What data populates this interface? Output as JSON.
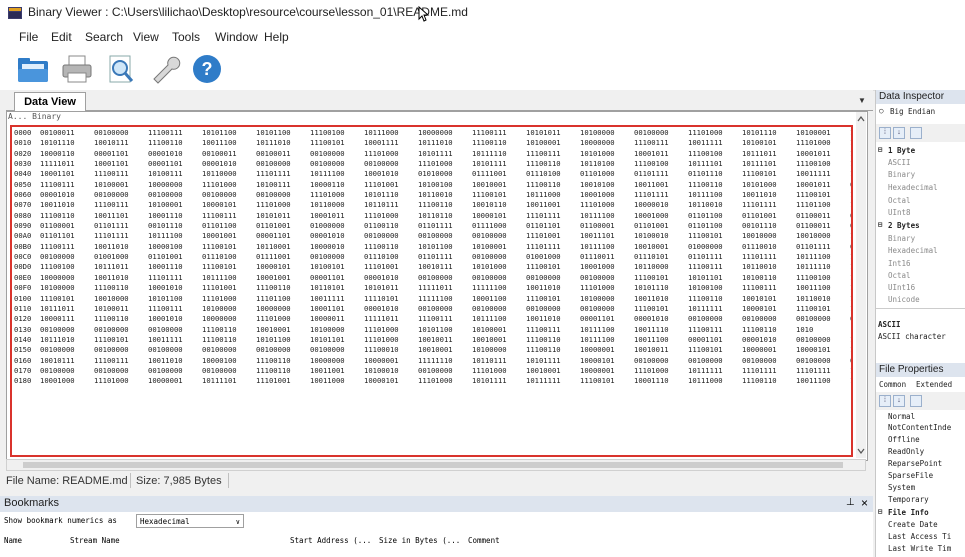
{
  "window": {
    "title": "Binary Viewer : C:\\Users\\lilichao\\Desktop\\resource\\course\\lesson_01\\README.md"
  },
  "menu": [
    "File",
    "Edit",
    "Search",
    "View",
    "Tools",
    "Window",
    "Help"
  ],
  "toolbar": {
    "icons": [
      "open-folder-icon",
      "print-icon",
      "print-preview-icon",
      "tools-wrench-icon",
      "help-icon"
    ]
  },
  "data_view": {
    "tab_label": "Data View",
    "col_header": "A... Binary",
    "rows": [
      {
        "addr": "0000",
        "cells": [
          "00100011",
          "00100000",
          "11100111",
          "10101100",
          "10101100",
          "11100100",
          "10111000",
          "10000000",
          "11100111",
          "10101011",
          "10100000",
          "00100000",
          "11101000",
          "10101110",
          "10100001",
          "1110"
        ]
      },
      {
        "addr": "0010",
        "cells": [
          "10101110",
          "10010111",
          "11100110",
          "10011100",
          "10111010",
          "11100101",
          "10001111",
          "10111010",
          "11100110",
          "10100001",
          "10000000",
          "11100111",
          "10011111",
          "10100101",
          "11101000",
          "1010"
        ]
      },
      {
        "addr": "0020",
        "cells": [
          "10000110",
          "00001101",
          "00001010",
          "00100011",
          "00100011",
          "00100000",
          "11101000",
          "10101111",
          "10111110",
          "11100111",
          "10101000",
          "10001011",
          "11100100",
          "10111011",
          "10001011",
          "1110"
        ]
      },
      {
        "addr": "0030",
        "cells": [
          "11111011",
          "10001101",
          "00001101",
          "00001010",
          "00100000",
          "00100000",
          "00100000",
          "11101000",
          "10101111",
          "11100110",
          "10110100",
          "11100100",
          "10111101",
          "10111101",
          "11100100",
          "1011"
        ]
      },
      {
        "addr": "0040",
        "cells": [
          "10001101",
          "11100111",
          "10100111",
          "10110000",
          "11101111",
          "10111100",
          "10001010",
          "01010000",
          "01111001",
          "01110100",
          "01101000",
          "01101111",
          "01101110",
          "11100101",
          "10011111",
          "1010"
        ]
      },
      {
        "addr": "0050",
        "cells": [
          "11100111",
          "10100001",
          "10000000",
          "11101000",
          "10100111",
          "10000110",
          "11101001",
          "10100100",
          "10010001",
          "11100110",
          "10010100",
          "10011001",
          "11100110",
          "10101000",
          "10001011",
          "0000"
        ]
      },
      {
        "addr": "0060",
        "cells": [
          "00001010",
          "00100000",
          "00100000",
          "00100000",
          "00100000",
          "11101000",
          "10101110",
          "10110010",
          "11100101",
          "10111000",
          "10001000",
          "11101111",
          "10111100",
          "10011010",
          "11100101",
          "1011"
        ]
      },
      {
        "addr": "0070",
        "cells": [
          "10011010",
          "11100111",
          "10100001",
          "10000101",
          "11101000",
          "10110000",
          "10110111",
          "11100110",
          "10010110",
          "10011001",
          "11101000",
          "10000010",
          "10110010",
          "11101111",
          "11101100",
          "1000"
        ]
      },
      {
        "addr": "0080",
        "cells": [
          "11100110",
          "10011101",
          "10001110",
          "11100111",
          "10101011",
          "10001011",
          "11101000",
          "10110110",
          "10000101",
          "11101111",
          "10111100",
          "10001000",
          "01101100",
          "01101001",
          "01100011",
          "0110"
        ]
      },
      {
        "addr": "0090",
        "cells": [
          "01100001",
          "01101111",
          "00101110",
          "01101100",
          "01101001",
          "01000000",
          "01100110",
          "01101111",
          "01111000",
          "01101101",
          "01100001",
          "01101001",
          "01101100",
          "00101110",
          "01100011",
          "0110"
        ]
      },
      {
        "addr": "00A0",
        "cells": [
          "01101101",
          "11101111",
          "10111100",
          "10001001",
          "00001101",
          "00001010",
          "00100000",
          "00100000",
          "00100000",
          "11101001",
          "10011101",
          "10100010",
          "11100101",
          "10010000",
          "10010000",
          "1001"
        ]
      },
      {
        "addr": "00B0",
        "cells": [
          "11100111",
          "10011010",
          "10000100",
          "11100101",
          "10110001",
          "10000010",
          "11100110",
          "10101100",
          "10100001",
          "11101111",
          "10111100",
          "10010001",
          "01000000",
          "01110010",
          "01101111",
          "0110"
        ]
      },
      {
        "addr": "00C0",
        "cells": [
          "00100000",
          "01001000",
          "01101001",
          "01110100",
          "01111001",
          "00100000",
          "01110100",
          "01101111",
          "00100000",
          "01001000",
          "01110011",
          "01110101",
          "01101111",
          "11101111",
          "10111100",
          "1000"
        ]
      },
      {
        "addr": "00D0",
        "cells": [
          "11100100",
          "10111011",
          "10001110",
          "11100101",
          "10000101",
          "10100101",
          "11101001",
          "10010111",
          "10101000",
          "11100101",
          "10001000",
          "10110000",
          "11100111",
          "10110010",
          "10111110",
          "1011"
        ]
      },
      {
        "addr": "00E0",
        "cells": [
          "10000000",
          "10011010",
          "11101111",
          "10111100",
          "10001001",
          "00001101",
          "00001010",
          "00100000",
          "00100000",
          "00100000",
          "00100000",
          "11100101",
          "10101101",
          "10100110",
          "11100100",
          "1010"
        ]
      },
      {
        "addr": "00F0",
        "cells": [
          "10100000",
          "11100110",
          "10001010",
          "11101001",
          "11100110",
          "10110101",
          "10101011",
          "11111011",
          "11111100",
          "10011010",
          "11101000",
          "10101110",
          "10100100",
          "11100111",
          "10011100",
          "1010"
        ]
      },
      {
        "addr": "0100",
        "cells": [
          "11100101",
          "10010000",
          "10101100",
          "11101000",
          "11101100",
          "10011111",
          "11110101",
          "11111100",
          "10001100",
          "11100101",
          "10100000",
          "10011010",
          "11100110",
          "10010101",
          "10110010",
          "1010"
        ]
      },
      {
        "addr": "0110",
        "cells": [
          "10111011",
          "10100011",
          "11100111",
          "10100000",
          "10000000",
          "10001101",
          "00001010",
          "00100000",
          "00100000",
          "00100000",
          "00100000",
          "11100101",
          "10111111",
          "10000101",
          "11100101",
          "1011"
        ]
      },
      {
        "addr": "0120",
        "cells": [
          "10000111",
          "11100110",
          "10001010",
          "10000000",
          "11101000",
          "10000011",
          "11111011",
          "11100111",
          "10111100",
          "10011010",
          "00001101",
          "00001010",
          "00100000",
          "00100000",
          "00100000",
          "0010"
        ]
      },
      {
        "addr": "0130",
        "cells": [
          "00100000",
          "00100000",
          "00100000",
          "11100110",
          "10010001",
          "10100000",
          "11101000",
          "10101100",
          "10100001",
          "11100111",
          "10111100",
          "10011110",
          "11100111",
          "11100110",
          "1010"
        ]
      },
      {
        "addr": "0140",
        "cells": [
          "10111010",
          "11100101",
          "10011111",
          "11100110",
          "10101100",
          "10101101",
          "11101000",
          "10010011",
          "10010001",
          "11100110",
          "10111100",
          "10011100",
          "00001101",
          "00001010",
          "00100000",
          "1011"
        ]
      },
      {
        "addr": "0150",
        "cells": [
          "00100000",
          "00100000",
          "00100000",
          "00100000",
          "00100000",
          "00100000",
          "11100010",
          "10010001",
          "10100000",
          "11100110",
          "10000001",
          "10010011",
          "11100101",
          "10000001",
          "10000101",
          "1001"
        ]
      },
      {
        "addr": "0160",
        "cells": [
          "10010111",
          "11100111",
          "10011010",
          "10000100",
          "11100110",
          "10000000",
          "10000001",
          "11111110",
          "10110111",
          "10101111",
          "10000101",
          "00100000",
          "00100000",
          "00100000",
          "00100000",
          "0010"
        ]
      },
      {
        "addr": "0170",
        "cells": [
          "00100000",
          "00100000",
          "00100000",
          "00100000",
          "11100110",
          "10011001",
          "10100010",
          "00100000",
          "11101000",
          "10010001",
          "10000001",
          "11101000",
          "10111111",
          "11101111",
          "11101111",
          "1001"
        ]
      },
      {
        "addr": "0180",
        "cells": [
          "10001000",
          "11101000",
          "10000001",
          "10111101",
          "11101001",
          "10011000",
          "10000101",
          "11101000",
          "10101111",
          "10111111",
          "11100101",
          "10001110",
          "10111000",
          "11100110",
          "10011100",
          "1010"
        ]
      }
    ]
  },
  "status": {
    "file_name": "File Name: README.md",
    "size": "Size: 7,985 Bytes"
  },
  "bookmarks": {
    "title": "Bookmarks",
    "show_label": "Show bookmark numerics as",
    "select_value": "Hexadecimal",
    "columns": [
      "Name",
      "Stream Name",
      "Start Address (...",
      "Size in Bytes (...",
      "Comment"
    ]
  },
  "data_inspector": {
    "title": "Data Inspector",
    "big_endian": "Big Endian",
    "groups": [
      {
        "label": "1 Byte",
        "items": [
          "ASCII",
          "Binary",
          "Hexadecimal",
          "Octal",
          "UInt8"
        ]
      },
      {
        "label": "2 Bytes",
        "items": [
          "Binary",
          "Hexadecimal",
          "Int16",
          "Octal",
          "UInt16",
          "Unicode"
        ]
      }
    ],
    "ascii_label": "ASCII",
    "ascii_desc": "ASCII character"
  },
  "file_properties": {
    "title": "File Properties",
    "tabs": [
      "Common",
      "Extended"
    ],
    "items": [
      "Normal",
      "NotContentInde",
      "Offline",
      "ReadOnly",
      "ReparsePoint",
      "SparseFile",
      "System",
      "Temporary"
    ],
    "group": "File Info",
    "group_items": [
      "Create Date",
      "Last Access Ti",
      "Last Write Tim"
    ]
  },
  "colors": {
    "highlight_border": "#d9332c",
    "panel_title_bg": "#dde4ee"
  }
}
